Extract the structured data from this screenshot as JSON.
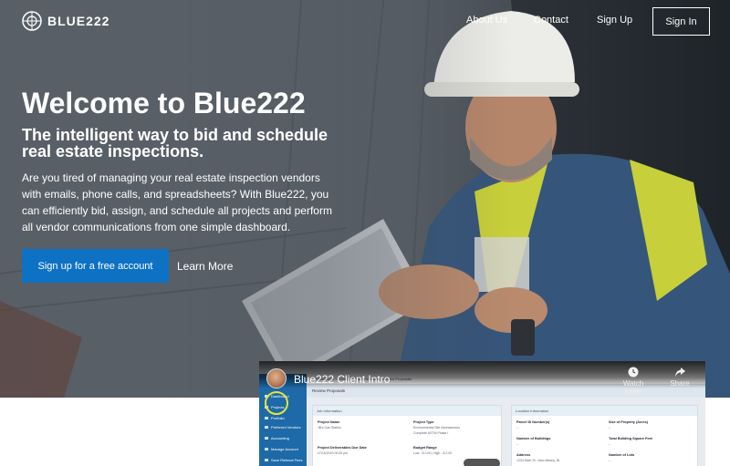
{
  "brand": {
    "name": "BLUE222"
  },
  "nav": {
    "links": [
      "About Us",
      "Contact",
      "Sign Up"
    ],
    "signin": "Sign In"
  },
  "hero": {
    "title": "Welcome to Blue222",
    "subtitle": "The intelligent way to bid and schedule real estate inspections.",
    "body": "Are you tired of managing your real estate inspection vendors with emails, phone calls, and spreadsheets? With Blue222, you can efficiently bid, assign, and schedule all projects and perform all vendor communications from one simple dashboard.",
    "cta": "Sign up for a free account",
    "learn_more": "Learn More"
  },
  "video": {
    "title": "Blue222 Client Intro",
    "watch_later": "Watch Later",
    "share": "Share",
    "app": {
      "sidebar": [
        "Dashboard",
        "Projects",
        "Portfolio",
        "Preferred Vendors",
        "Accounting",
        "Manage Account",
        "Save Referral Fees"
      ],
      "crumbs": "Dashboard  /  Pending RFPs  /  Proposals  /  Review Proposals",
      "page_title": "Review Proposals",
      "panels": {
        "job": "Job Information",
        "location": "Location Information"
      },
      "job_fields": [
        {
          "label": "Project Name",
          "value": "Jill's Gas Station"
        },
        {
          "label": "Project Type",
          "value": "Environmental Site Assessments"
        },
        {
          "label": "",
          "value": "Complete ASTM Phase I"
        },
        {
          "label": "Project Deliverables Due Date",
          "value": "07/15/2020 00:00 pm"
        },
        {
          "label": "Budget Range",
          "value": "Low - $ 0.00  |  High - $ 0.00"
        }
      ],
      "location_fields": [
        {
          "label": "Parcel ID Number(s)",
          "value": "--"
        },
        {
          "label": "Size of Property (Acres)",
          "value": "--"
        },
        {
          "label": "Number of Buildings",
          "value": "--"
        },
        {
          "label": "Total Building Square Feet",
          "value": "--"
        },
        {
          "label": "Address",
          "value": "1234 Main St., New Albany, IN"
        },
        {
          "label": "Number of Lots",
          "value": "--"
        }
      ]
    }
  },
  "colors": {
    "primary": "#0e72c4",
    "sidebar": "#1e6aa8"
  }
}
